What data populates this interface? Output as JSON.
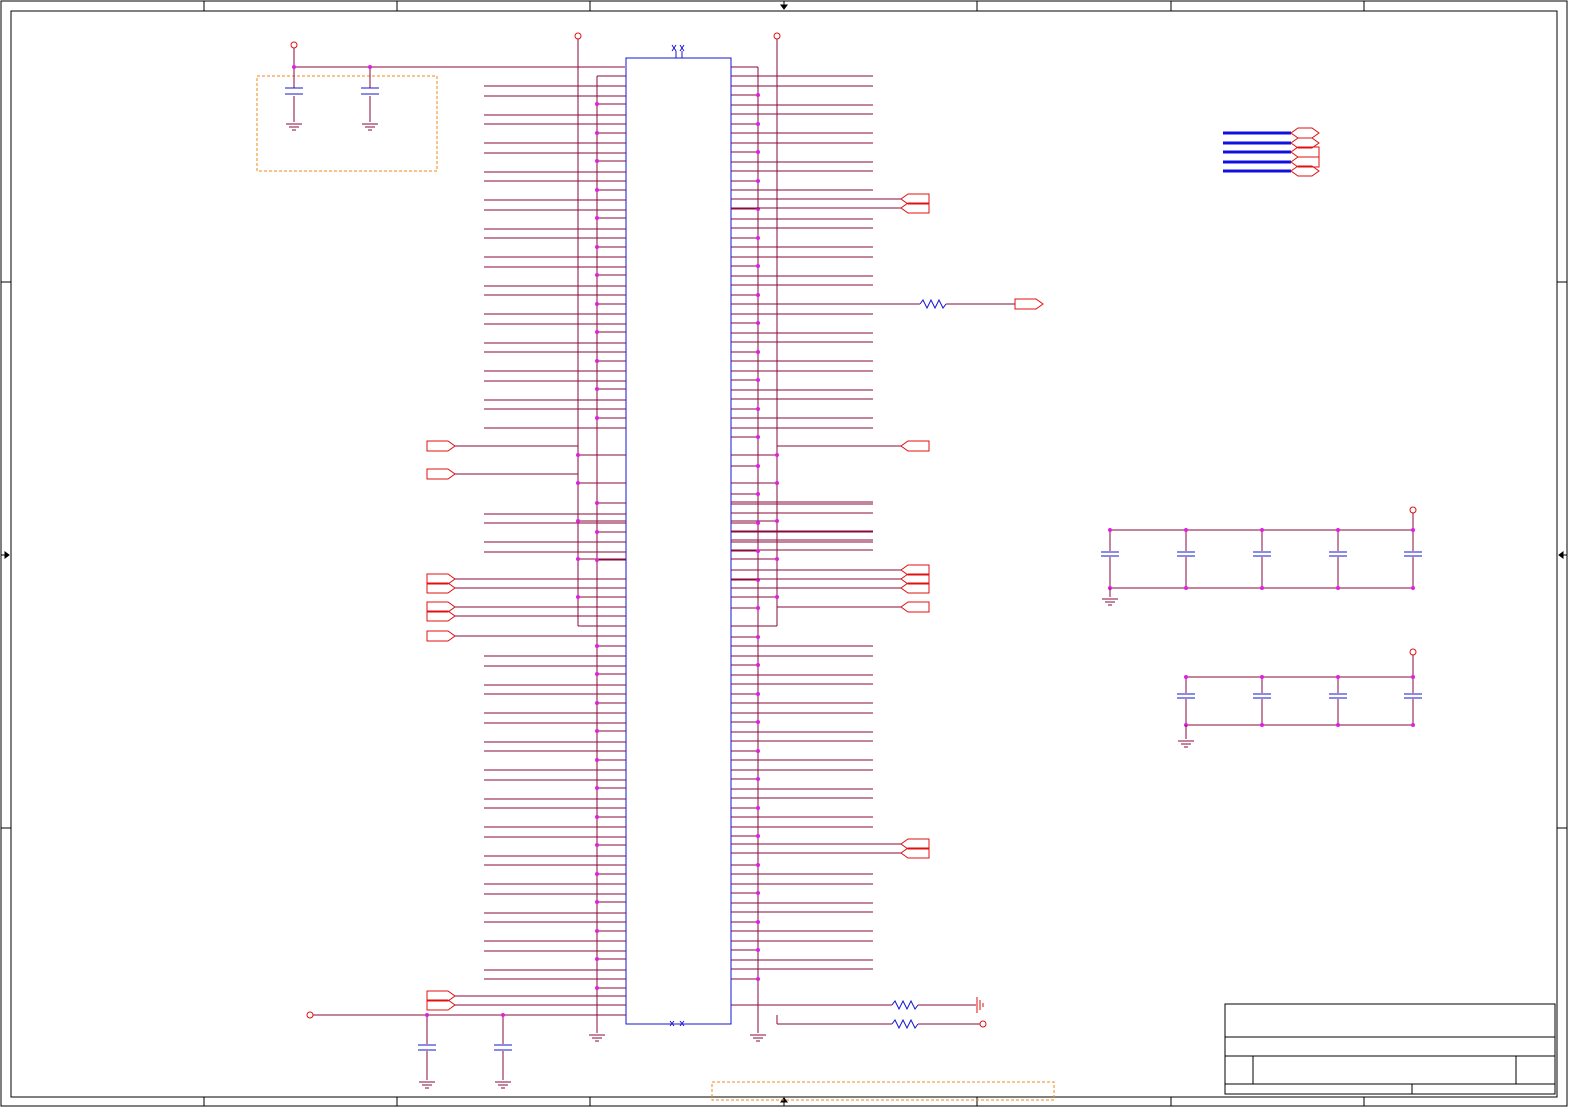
{
  "colors": {
    "frame": "#000000",
    "wire": "#8b0a3c",
    "component": "#1414d2",
    "connector": "#e01010",
    "junction": "#e020e0",
    "group_box": "#f08a1a",
    "bus": "#1010e0"
  },
  "title_block": {
    "title": "",
    "size": "",
    "document_number": "",
    "revision": "",
    "date": "",
    "sheet": ""
  },
  "icons": {
    "power_port": "open-circle-icon",
    "ground": "ground-icon",
    "capacitor": "capacitor-icon",
    "resistor": "resistor-icon",
    "off_page_connector": "double-arrow-connector-icon",
    "junction": "junction-dot-icon"
  }
}
